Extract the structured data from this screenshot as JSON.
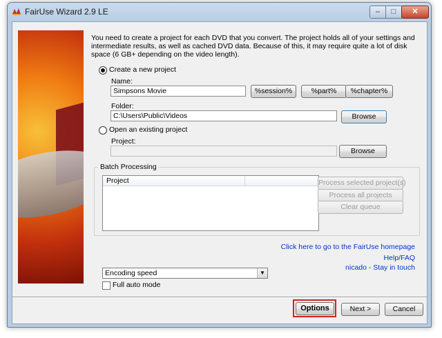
{
  "window": {
    "title": "FairUse Wizard 2.9 LE",
    "controls": {
      "minimize": "–",
      "maximize": "□",
      "close": "✕"
    }
  },
  "intro": "You need to create a project for each DVD that you convert. The project holds all of your settings and intermediate results, as well as cached DVD data. Because of this, it may require quite a lot of disk space (6 GB+ depending on the video length).",
  "new_project": {
    "radio_label": "Create a new project",
    "selected": true,
    "name_label": "Name:",
    "name_value": "Simpsons Movie",
    "tokens": [
      "%session%",
      "%part%",
      "%chapter%"
    ],
    "folder_label": "Folder:",
    "folder_value": "C:\\Users\\Public\\Videos",
    "browse_label": "Browse"
  },
  "existing_project": {
    "radio_label": "Open an existing project",
    "selected": false,
    "project_label": "Project:",
    "project_value": "",
    "browse_label": "Browse"
  },
  "batch": {
    "title": "Batch Processing",
    "column_header": "Project",
    "process_selected": "Process selected project(s)",
    "process_all": "Process all projects",
    "clear_queue": "Clear queue"
  },
  "links": {
    "homepage": "Click here to go to the FairUse homepage",
    "help": "Help/FAQ",
    "author": "nicado - Stay in touch"
  },
  "encoding": {
    "selected": "Encoding speed"
  },
  "full_auto": {
    "label": "Full auto mode",
    "checked": false
  },
  "footer": {
    "options": "Options",
    "next": "Next >",
    "cancel": "Cancel"
  },
  "colors": {
    "highlight": "#d81e1e",
    "link": "#0033cc"
  }
}
